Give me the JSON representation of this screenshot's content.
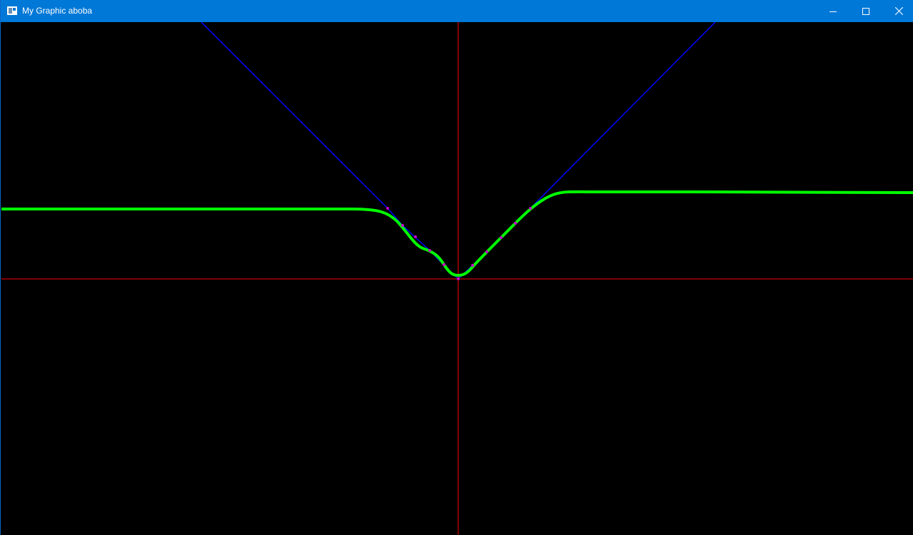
{
  "window": {
    "title": "My Graphic aboba",
    "titlebar_color": "#0078d7",
    "background_color": "#000000"
  },
  "controls": {
    "minimize_icon": "minimize-icon",
    "maximize_icon": "maximize-icon",
    "close_icon": "close-icon"
  },
  "colors": {
    "axes": "#ff0000",
    "curve": "#00ff00",
    "tangents": "#0000ff",
    "control_points": "#cc00cc"
  }
}
